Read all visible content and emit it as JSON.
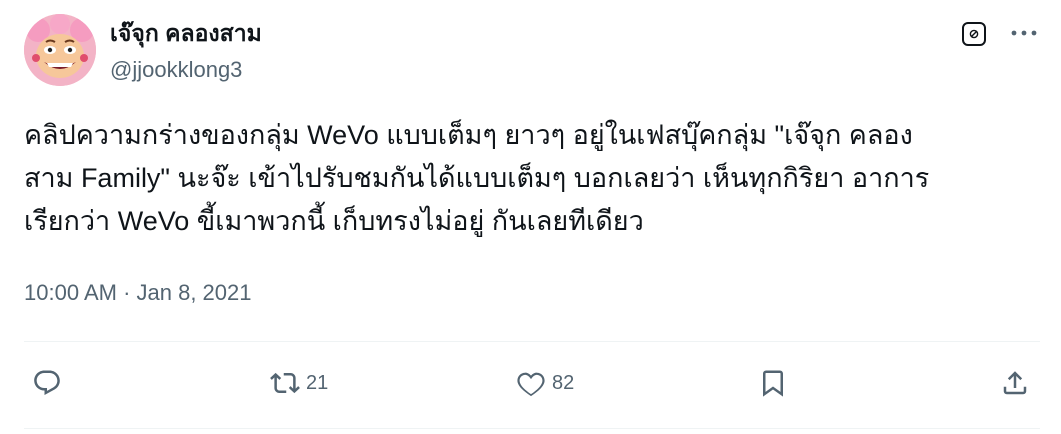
{
  "author": {
    "display_name": "เจ๊จุก คลองสาม",
    "handle": "@jjookklong3",
    "avatar_icon": "cartoon-avatar-icon"
  },
  "header_actions": {
    "grok_icon": "grok-icon",
    "more_icon": "more-dots-icon"
  },
  "tweet": {
    "text_lines": [
      "คลิปความกร่างของกลุ่ม WeVo แบบเต็มๆ ยาวๆ อยู่ในเฟสบุ๊คกลุ่ม \"เจ๊จุก คลอง",
      "สาม Family\" นะจ๊ะ เข้าไปรับชมกันได้แบบเต็มๆ บอกเลยว่า เห็นทุกกิริยา อาการ",
      "เรียกว่า WeVo ขี้เมาพวกนี้ เก็บทรงไม่อยู่ กันเลยทีเดียว"
    ],
    "timestamp": "10:00 AM · Jan 8, 2021"
  },
  "actions": {
    "reply_icon": "reply-icon",
    "retweet_icon": "retweet-icon",
    "retweet_count": "21",
    "like_icon": "heart-icon",
    "like_count": "82",
    "bookmark_icon": "bookmark-icon",
    "share_icon": "share-icon"
  },
  "colors": {
    "text_primary": "#0f1419",
    "text_secondary": "#536471",
    "divider": "#eff3f4"
  }
}
